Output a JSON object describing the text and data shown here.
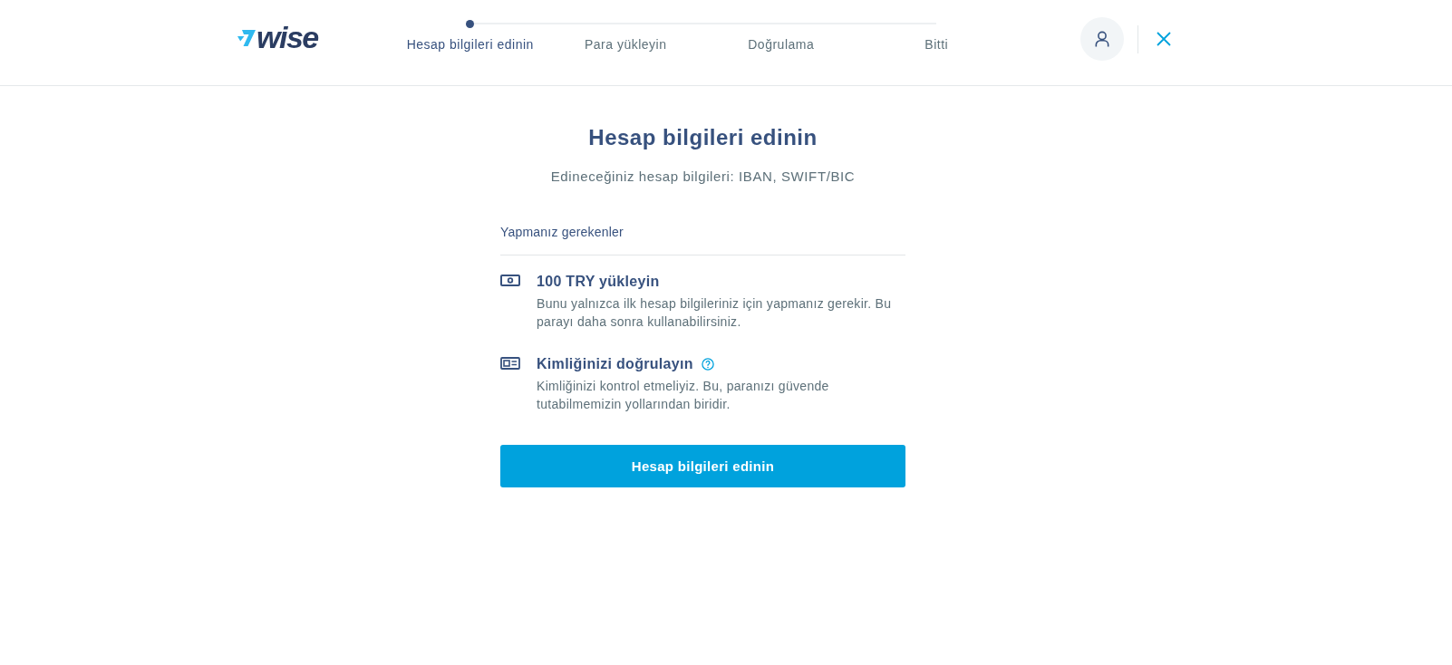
{
  "header": {
    "logo": {
      "wordmark": "wise"
    },
    "steps": [
      {
        "label": "Hesap bilgileri edinin",
        "selected": true
      },
      {
        "label": "Para yükleyin",
        "selected": false
      },
      {
        "label": "Doğrulama",
        "selected": false
      },
      {
        "label": "Bitti",
        "selected": false
      }
    ]
  },
  "main": {
    "title": "Hesap bilgileri edinin",
    "subtitle": "Edineceğiniz hesap bilgileri: IBAN, SWIFT/BIC",
    "section_heading": "Yapmanız gerekenler",
    "tasks": [
      {
        "kind": "money",
        "title": "100 TRY yükleyin",
        "description": "Bunu yalnızca ilk hesap bilgileriniz için yapmanız gerekir. Bu parayı daha sonra kullanabilirsiniz.",
        "help": false
      },
      {
        "kind": "id",
        "title": "Kimliğinizi doğrulayın",
        "description": "Kimliğinizi kontrol etmeliyiz. Bu, paranızı güvende tutabilmemizin yollarından biridir.",
        "help": true
      }
    ],
    "button": "Hesap bilgileri edinin"
  }
}
